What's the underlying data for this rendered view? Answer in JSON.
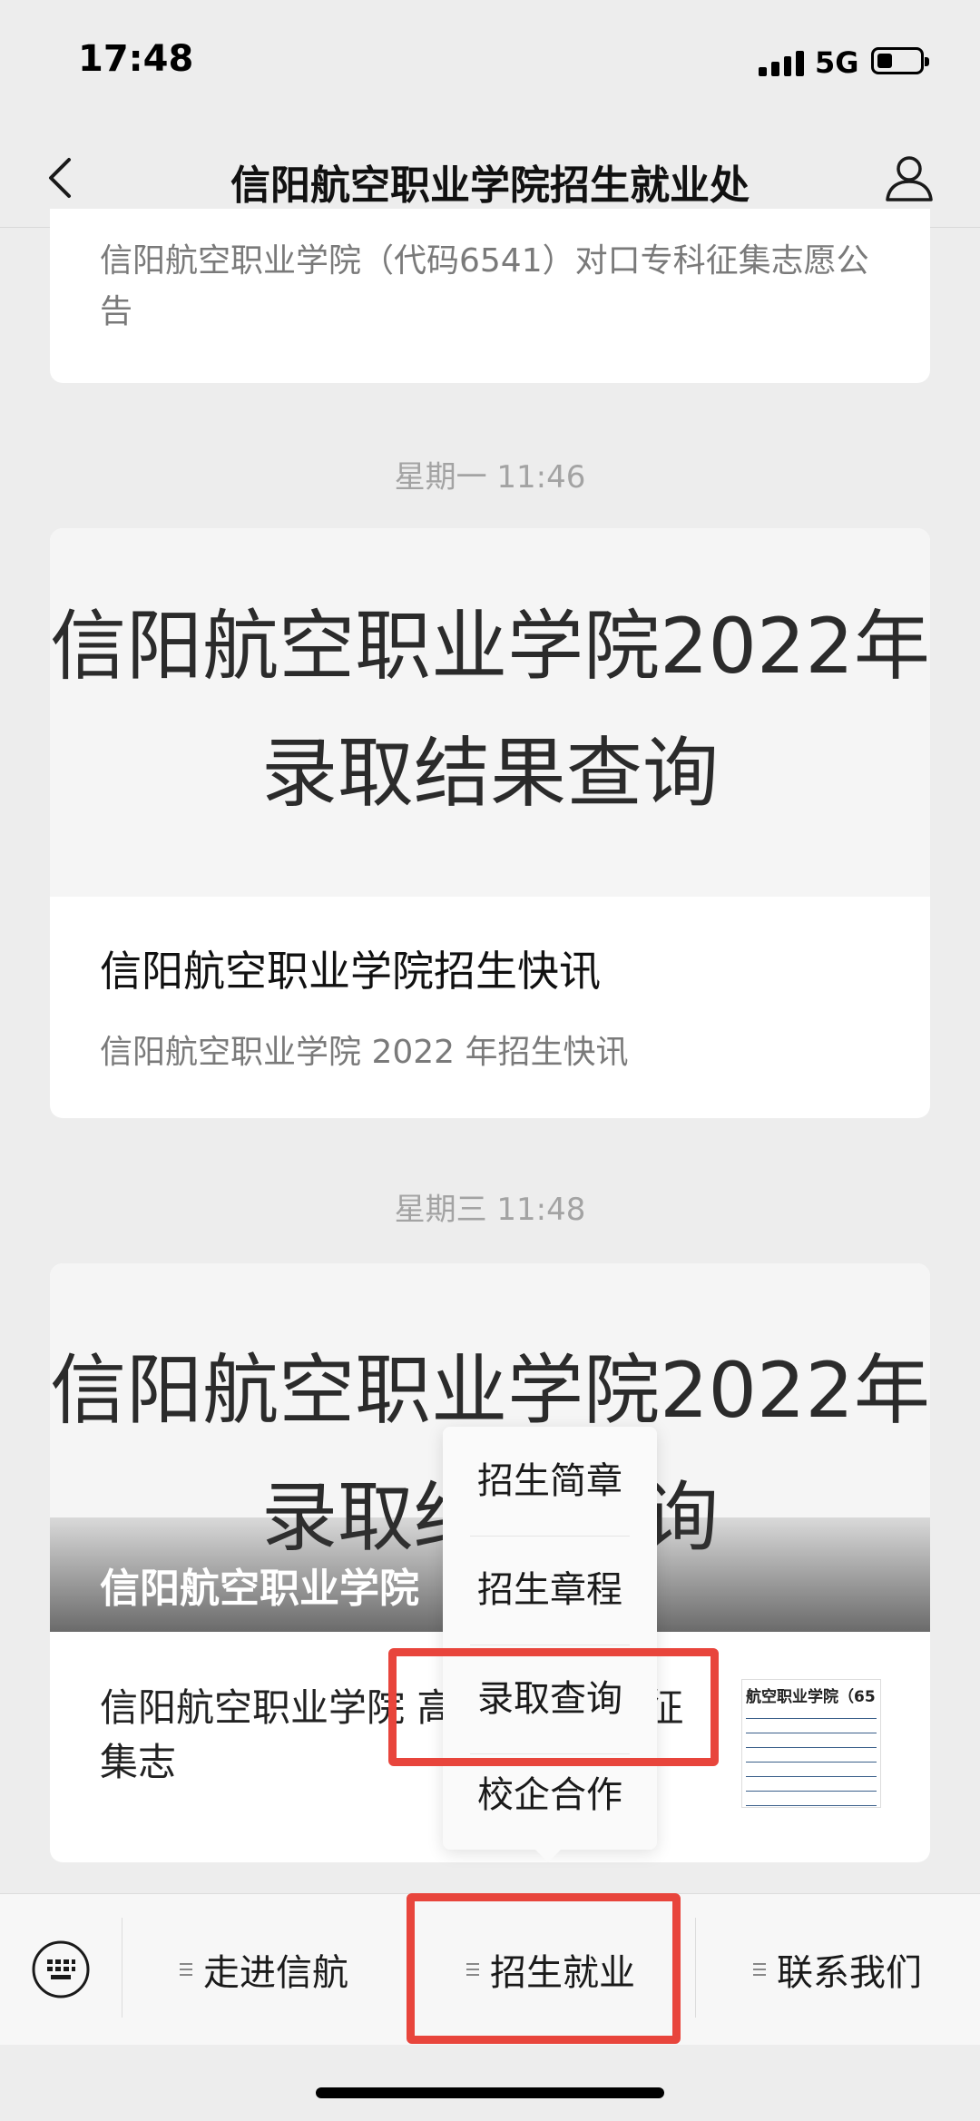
{
  "status_bar": {
    "time": "17:48",
    "network": "5G"
  },
  "nav": {
    "title": "信阳航空职业学院招生就业处"
  },
  "messages": [
    {
      "description": "信阳航空职业学院（代码6541）对口专科征集志愿公告"
    },
    {
      "timestamp": "星期一 11:46",
      "cover_line1": "信阳航空职业学院2022年",
      "cover_line2": "录取结果查询",
      "title": "信阳航空职业学院招生快讯",
      "subtitle": "信阳航空职业学院 2022 年招生快讯"
    },
    {
      "timestamp": "星期三 11:48",
      "cover_line1": "信阳航空职业学院2022年",
      "cover_line2": "录取结果查询",
      "overlay_title": "信阳航空职业学院 （二）",
      "description": "信阳航空职业学院 高职高专批次征集志",
      "thumb_title": "航空职业学院（65"
    }
  ],
  "popup_menu": {
    "items": [
      "招生简章",
      "招生章程",
      "录取查询",
      "校企合作"
    ]
  },
  "bottom_menu": {
    "items": [
      "走进信航",
      "招生就业",
      "联系我们"
    ]
  },
  "colors": {
    "highlight": "#e8453c",
    "background": "#ededed"
  },
  "icons": [
    "back-icon",
    "profile-icon",
    "keyboard-icon",
    "menu-lines-icon"
  ]
}
